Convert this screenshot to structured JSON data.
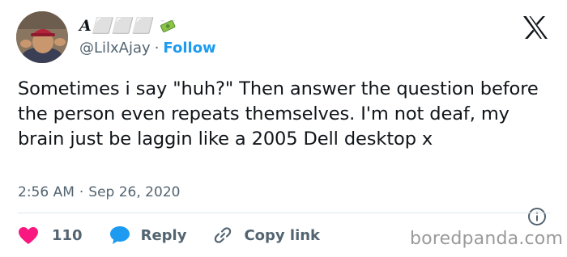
{
  "author": {
    "display_name": "A⬜⬜⬜",
    "handle": "@LilxAjay",
    "follow_label": "Follow",
    "avatar_icon": "profile-photo",
    "badge_icon": "money-with-wings-emoji"
  },
  "header": {
    "separator": "·",
    "platform_icon": "x-logo"
  },
  "tweet": {
    "text": "Sometimes i say \"huh?\" Then answer the question before the person even repeats themselves. I'm not deaf, my brain just be laggin like a 2005 Dell desktop x",
    "time": "2:56 AM",
    "date": "Sep 26, 2020",
    "separator": "·"
  },
  "actions": {
    "like_count": "110",
    "reply_label": "Reply",
    "copy_link_label": "Copy link",
    "like_color": "#f91880",
    "reply_color": "#1d9bf0"
  },
  "watermark": {
    "text": "boredpanda.com"
  },
  "colors": {
    "accent": "#1d9bf0",
    "text": "#0f1419",
    "secondary": "#536471"
  }
}
